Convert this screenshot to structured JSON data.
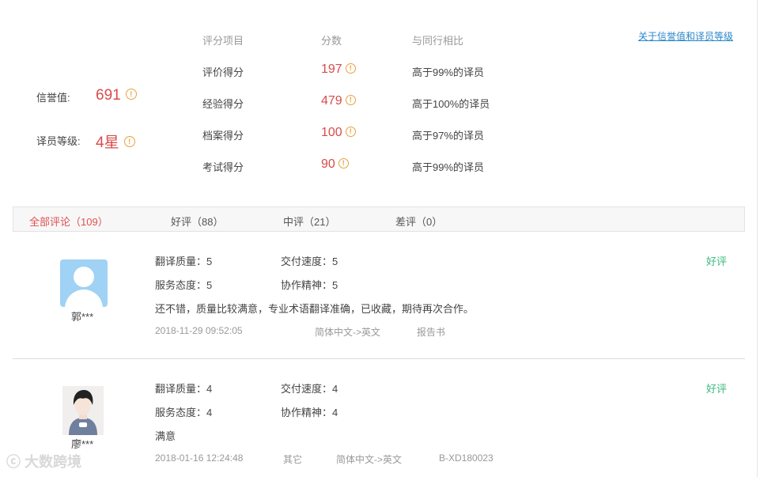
{
  "summary": {
    "credit_label": "信誉值:",
    "credit_value": "691",
    "level_label": "译员等级:",
    "level_value": "4星",
    "link_text": "关于信誉值和译员等级",
    "headers": {
      "item": "评分项目",
      "score": "分数",
      "compare": "与同行相比"
    },
    "rows": [
      {
        "item": "评价得分",
        "score": "197",
        "compare": "高于99%的译员"
      },
      {
        "item": "经验得分",
        "score": "479",
        "compare": "高于100%的译员"
      },
      {
        "item": "档案得分",
        "score": "100",
        "compare": "高于97%的译员"
      },
      {
        "item": "考试得分",
        "score": "90",
        "compare": "高于99%的译员"
      }
    ]
  },
  "tabs": [
    {
      "label": "全部评论（109）",
      "active": true
    },
    {
      "label": "好评（88）",
      "active": false
    },
    {
      "label": "中评（21）",
      "active": false
    },
    {
      "label": "差评（0）",
      "active": false
    }
  ],
  "reviews": [
    {
      "name": "郭***",
      "rating": "好评",
      "quality_label": "翻译质量：",
      "quality": "5",
      "speed_label": "交付速度：",
      "speed": "5",
      "attitude_label": "服务态度：",
      "attitude": "5",
      "cooperation_label": "协作精神：",
      "cooperation": "5",
      "comment": "还不错，质量比较满意，专业术语翻译准确，已收藏，期待再次合作。",
      "date": "2018-11-29 09:52:05",
      "field": "",
      "lang": "简体中文->英文",
      "doc": "报告书"
    },
    {
      "name": "廖***",
      "rating": "好评",
      "quality_label": "翻译质量：",
      "quality": "4",
      "speed_label": "交付速度：",
      "speed": "4",
      "attitude_label": "服务态度：",
      "attitude": "4",
      "cooperation_label": "协作精神：",
      "cooperation": "4",
      "comment": "满意",
      "date": "2018-01-16 12:24:48",
      "field": "其它",
      "lang": "简体中文->英文",
      "doc": "B-XD180023"
    }
  ],
  "watermark": "大数跨境",
  "colors": {
    "accent_red": "#d94b4b",
    "good_green": "#3cba7d",
    "link_blue": "#2a86c8",
    "icon_orange": "#e8a13c"
  }
}
